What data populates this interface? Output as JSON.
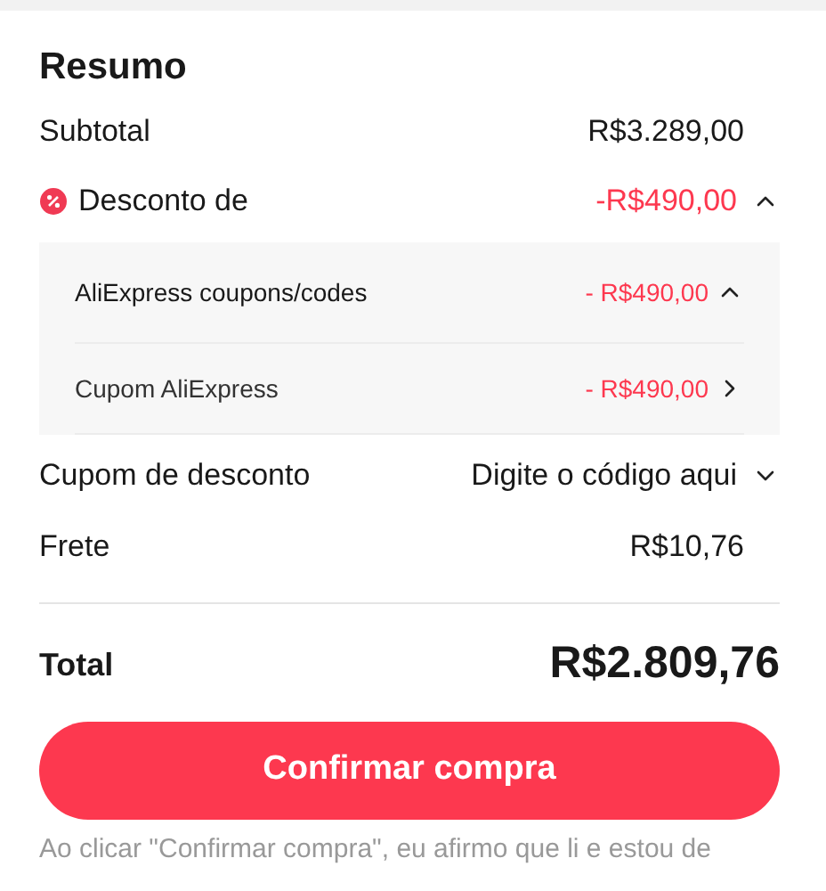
{
  "title": "Resumo",
  "subtotal": {
    "label": "Subtotal",
    "value": "R$3.289,00"
  },
  "discount": {
    "label": "Desconto de",
    "value": "-R$490,00",
    "expanded": true,
    "groups": [
      {
        "label": "AliExpress coupons/codes",
        "value": "- R$490,00",
        "expanded": true,
        "items": [
          {
            "label": "Cupom AliExpress",
            "value": "- R$490,00"
          }
        ]
      }
    ]
  },
  "coupon_code": {
    "label": "Cupom de desconto",
    "placeholder": "Digite o código aqui",
    "expanded": false
  },
  "shipping": {
    "label": "Frete",
    "value": "R$10,76"
  },
  "total": {
    "label": "Total",
    "value": "R$2.809,76"
  },
  "confirm_button": "Confirmar compra",
  "disclaimer": "Ao clicar \"Confirmar compra\", eu afirmo que li e estou de"
}
